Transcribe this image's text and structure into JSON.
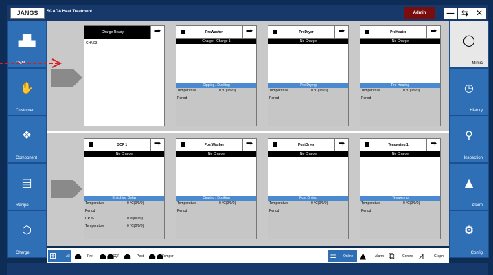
{
  "app": {
    "logo": "JANGS",
    "title": "SCADA Heat Treatment",
    "user": "Admin"
  },
  "window_controls": [
    "—",
    "⇆",
    "✕"
  ],
  "left_nav": [
    {
      "label": "CEM",
      "icon": "factory-icon"
    },
    {
      "label": "Customer",
      "icon": "customer-icon"
    },
    {
      "label": "Component",
      "icon": "component-icon"
    },
    {
      "label": "Recipe",
      "icon": "recipe-icon"
    },
    {
      "label": "Charge",
      "icon": "cube-icon"
    }
  ],
  "right_nav": [
    {
      "label": "Mimic",
      "icon": "circle-icon"
    },
    {
      "label": "History",
      "icon": "clock-icon"
    },
    {
      "label": "Inspection",
      "icon": "inspection-icon"
    },
    {
      "label": "Alarm",
      "icon": "bell-icon"
    },
    {
      "label": "Config",
      "icon": "gear-icon"
    }
  ],
  "ready_card": {
    "title": "Charge Ready",
    "item": "CHN03"
  },
  "stations": [
    {
      "name": "PreWasher",
      "charge": "Charge - Charge 1",
      "phase": "Dipping / Dunking",
      "rows": [
        {
          "k": "Temperature",
          "v": "0 °C(0/0/0)"
        },
        {
          "k": "Period",
          "v": ""
        }
      ]
    },
    {
      "name": "PreDryer",
      "charge": "No Charge",
      "phase": "Pre Drying",
      "rows": [
        {
          "k": "Temperature",
          "v": "0 °C(0/0/0)"
        },
        {
          "k": "Period",
          "v": ""
        }
      ]
    },
    {
      "name": "PreHeater",
      "charge": "No Charge",
      "phase": "Pre Heating",
      "rows": [
        {
          "k": "Temperature",
          "v": "0 °C(0/0/0)"
        },
        {
          "k": "Period",
          "v": ""
        }
      ]
    },
    {
      "name": "SQF 1",
      "charge": "No Charge",
      "phase": "Enriching Delay",
      "rows": [
        {
          "k": "Temperature",
          "v": "0 °C(0/0/0)"
        },
        {
          "k": "Period",
          "v": ""
        },
        {
          "k": "CP %",
          "v": "0 %(0/0/0)"
        },
        {
          "k": "Temperature",
          "v": "0 °C(0/0/0)"
        }
      ]
    },
    {
      "name": "PostWasher",
      "charge": "No Charge",
      "phase": "Dipping / Dunking",
      "rows": [
        {
          "k": "Temperature",
          "v": "0 °C(0/0/0)"
        },
        {
          "k": "Period",
          "v": ""
        }
      ]
    },
    {
      "name": "PostDryer",
      "charge": "No Charge",
      "phase": "Post Drying",
      "rows": [
        {
          "k": "Temperature",
          "v": "0 °C(0/0/0)"
        },
        {
          "k": "Period",
          "v": ""
        }
      ]
    },
    {
      "name": "Tempering 1",
      "charge": "No Charge",
      "phase": "Tempering",
      "rows": [
        {
          "k": "Temperature",
          "v": "0 °C(0/0/0)"
        },
        {
          "k": "Period",
          "v": ""
        }
      ]
    }
  ],
  "footer_left": [
    {
      "label": "All"
    },
    {
      "label": "Pre"
    },
    {
      "label": "SQF"
    },
    {
      "label": "Post"
    },
    {
      "label": "Temper"
    }
  ],
  "footer_right": [
    {
      "label": "Online"
    },
    {
      "label": "Alarm"
    },
    {
      "label": "Control"
    },
    {
      "label": "Graph"
    }
  ],
  "colors": {
    "frame": "#0d2c56",
    "nav_blue": "#2f6fb6",
    "phase_blue": "#4a8ad0",
    "admin_red": "#7a0e0e",
    "dashed_arrow": "#d62020"
  }
}
